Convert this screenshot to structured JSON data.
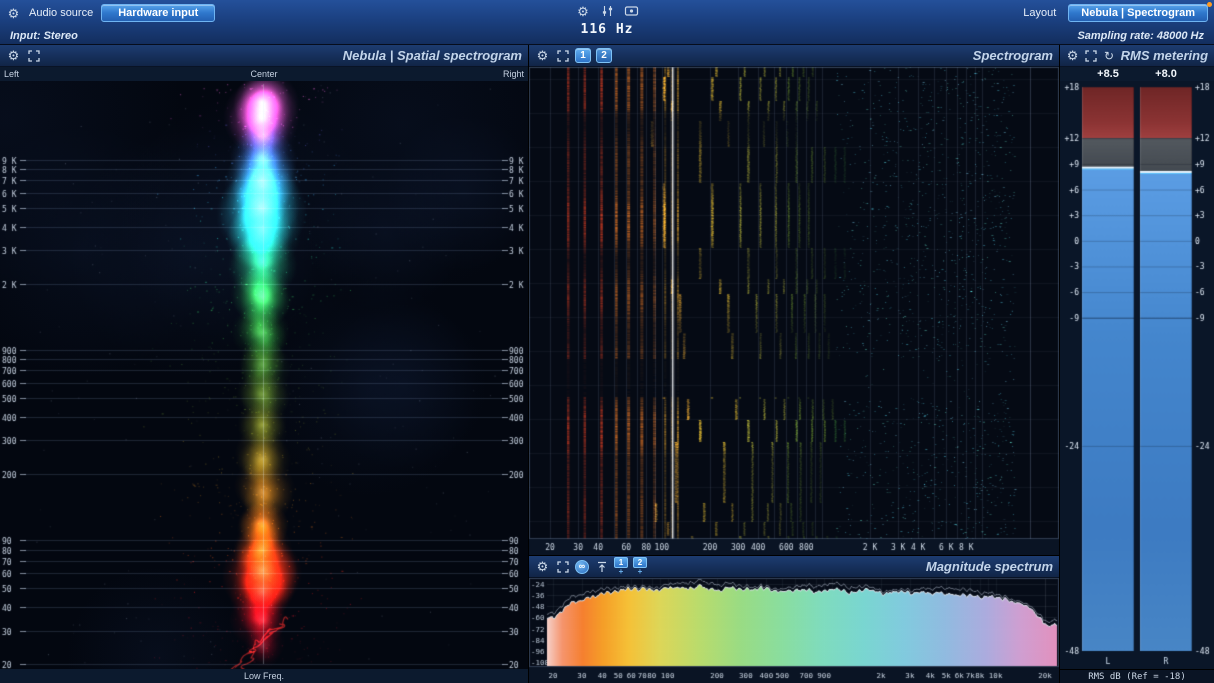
{
  "topbar": {
    "audio_source_label": "Audio source",
    "hardware_input_button": "Hardware input",
    "freq_readout": "116 Hz",
    "layout_button": "Layout",
    "preset_button": "Nebula | Spectrogram",
    "input_label": "Input: Stereo",
    "sampling_rate_label": "Sampling rate: 48000 Hz"
  },
  "panels": {
    "spatial": {
      "title": "Nebula | Spatial spectrogram",
      "left_label": "Left",
      "center_label": "Center",
      "right_label": "Right",
      "bottom_label": "Low Freq."
    },
    "spectrogram": {
      "title": "Spectrogram",
      "button1": "1",
      "button2": "2"
    },
    "magnitude": {
      "title": "Magnitude spectrum",
      "button1": "1",
      "button2": "2",
      "plus": "+",
      "freeze_glyph": "∞"
    },
    "rms": {
      "title": "RMS metering",
      "left_value": "+8.5",
      "right_value": "+8.0",
      "footer": "RMS dB (Ref = -18)"
    }
  },
  "theme": {
    "accent_blue": "#3a8de0",
    "meter_red": "#8c3434",
    "meter_gray": "#4b5158",
    "meter_blue": "#4486cd",
    "value_line": "#eaf6ff"
  },
  "chart_data": [
    {
      "name": "spatial_spectrogram",
      "type": "heatmap",
      "freq_range_hz": [
        20,
        22500
      ],
      "pan_labels": [
        "Left",
        "Center",
        "Right"
      ],
      "low_freq_label": "Low Freq.",
      "freq_ticks": [
        {
          "f": 9000,
          "label": "9 K"
        },
        {
          "f": 8000,
          "label": "8 K"
        },
        {
          "f": 7000,
          "label": "7 K"
        },
        {
          "f": 6000,
          "label": "6 K"
        },
        {
          "f": 5000,
          "label": "5 K"
        },
        {
          "f": 4000,
          "label": "4 K"
        },
        {
          "f": 3000,
          "label": "3 K"
        },
        {
          "f": 2000,
          "label": "2 K"
        },
        {
          "f": 900,
          "label": "900"
        },
        {
          "f": 800,
          "label": "800"
        },
        {
          "f": 700,
          "label": "700"
        },
        {
          "f": 600,
          "label": "600"
        },
        {
          "f": 500,
          "label": "500"
        },
        {
          "f": 400,
          "label": "400"
        },
        {
          "f": 300,
          "label": "300"
        },
        {
          "f": 200,
          "label": "200"
        },
        {
          "f": 90,
          "label": "90"
        },
        {
          "f": 80,
          "label": "80"
        },
        {
          "f": 70,
          "label": "70"
        },
        {
          "f": 60,
          "label": "60"
        },
        {
          "f": 50,
          "label": "50"
        },
        {
          "f": 40,
          "label": "40"
        },
        {
          "f": 30,
          "label": "30"
        },
        {
          "f": 20,
          "label": "20"
        }
      ],
      "energy_stops": [
        {
          "f": 18000,
          "c": "#ff5fd6",
          "r": 26,
          "a": 0.85
        },
        {
          "f": 15000,
          "c": "#f44fd0",
          "r": 30,
          "a": 0.9
        },
        {
          "f": 12000,
          "c": "#7a6bff",
          "r": 24,
          "a": 0.45
        },
        {
          "f": 9500,
          "c": "#4f8cff",
          "r": 26,
          "a": 0.55
        },
        {
          "f": 7000,
          "c": "#3fb9ff",
          "r": 30,
          "a": 0.75
        },
        {
          "f": 5000,
          "c": "#2fd8ee",
          "r": 34,
          "a": 0.95
        },
        {
          "f": 3800,
          "c": "#27e0c8",
          "r": 30,
          "a": 0.75
        },
        {
          "f": 2600,
          "c": "#2fe08a",
          "r": 26,
          "a": 0.55
        },
        {
          "f": 1700,
          "c": "#35d855",
          "r": 28,
          "a": 0.75
        },
        {
          "f": 1100,
          "c": "#3fcc3f",
          "r": 26,
          "a": 0.55
        },
        {
          "f": 750,
          "c": "#63c32f",
          "r": 22,
          "a": 0.42
        },
        {
          "f": 520,
          "c": "#8cc22a",
          "r": 20,
          "a": 0.38
        },
        {
          "f": 360,
          "c": "#b9c21f",
          "r": 20,
          "a": 0.38
        },
        {
          "f": 240,
          "c": "#e0b018",
          "r": 22,
          "a": 0.48
        },
        {
          "f": 160,
          "c": "#f09010",
          "r": 22,
          "a": 0.52
        },
        {
          "f": 110,
          "c": "#ff7708",
          "r": 22,
          "a": 0.6
        },
        {
          "f": 80,
          "c": "#ff5505",
          "r": 24,
          "a": 0.7
        },
        {
          "f": 62,
          "c": "#ff2a06",
          "r": 30,
          "a": 1.0
        },
        {
          "f": 48,
          "c": "#ff1208",
          "r": 26,
          "a": 0.88
        },
        {
          "f": 34,
          "c": "#e00a14",
          "r": 22,
          "a": 0.65
        },
        {
          "f": 25,
          "c": "#b00616",
          "r": 18,
          "a": 0.45
        }
      ]
    },
    {
      "name": "spectrogram",
      "type": "heatmap",
      "freq_range_hz": [
        20,
        30000
      ],
      "cursor_freq_hz": 116,
      "fundamental_hz": 116,
      "harmonics": 8,
      "low_band_freqs": [
        26,
        33,
        42,
        52,
        62,
        75,
        90,
        105,
        116,
        126
      ],
      "silence_rows": [
        [
          292,
          330
        ]
      ],
      "speckle_range_hz": [
        1200,
        16000
      ],
      "x_ticks": [
        {
          "f": 20,
          "label": "20"
        },
        {
          "f": 30,
          "label": "30"
        },
        {
          "f": 40,
          "label": "40"
        },
        {
          "f": 60,
          "label": "60"
        },
        {
          "f": 80,
          "label": "80"
        },
        {
          "f": 100,
          "label": "100"
        },
        {
          "f": 200,
          "label": "200"
        },
        {
          "f": 300,
          "label": "300"
        },
        {
          "f": 400,
          "label": "400"
        },
        {
          "f": 600,
          "label": "600"
        },
        {
          "f": 800,
          "label": "800"
        },
        {
          "f": 2000,
          "label": "2 K"
        },
        {
          "f": 3000,
          "label": "3 K"
        },
        {
          "f": 4000,
          "label": "4 K"
        },
        {
          "f": 6000,
          "label": "6 K"
        },
        {
          "f": 8000,
          "label": "8 K"
        }
      ]
    },
    {
      "name": "magnitude_spectrum",
      "type": "area",
      "ylabel_unit": "dB",
      "y_ticks": [
        -24,
        -36,
        -48,
        -60,
        -72,
        -84,
        -96,
        -108
      ],
      "x_ticks": [
        {
          "f": 20,
          "label": "20"
        },
        {
          "f": 30,
          "label": "30"
        },
        {
          "f": 40,
          "label": "40"
        },
        {
          "f": 50,
          "label": "50"
        },
        {
          "f": 60,
          "label": "60"
        },
        {
          "f": 70,
          "label": "70"
        },
        {
          "f": 80,
          "label": "80"
        },
        {
          "f": 100,
          "label": "100"
        },
        {
          "f": 200,
          "label": "200"
        },
        {
          "f": 300,
          "label": "300"
        },
        {
          "f": 400,
          "label": "400"
        },
        {
          "f": 500,
          "label": "500"
        },
        {
          "f": 700,
          "label": "700"
        },
        {
          "f": 900,
          "label": "900"
        },
        {
          "f": 2000,
          "label": "2k"
        },
        {
          "f": 3000,
          "label": "3k"
        },
        {
          "f": 4000,
          "label": "4k"
        },
        {
          "f": 5000,
          "label": "5k"
        },
        {
          "f": 6000,
          "label": "6k"
        },
        {
          "f": 7000,
          "label": "7k"
        },
        {
          "f": 8000,
          "label": "8k"
        },
        {
          "f": 10000,
          "label": "10k"
        },
        {
          "f": 20000,
          "label": "20k"
        }
      ],
      "points": [
        [
          20,
          -60
        ],
        [
          25,
          -46
        ],
        [
          32,
          -40
        ],
        [
          40,
          -35
        ],
        [
          50,
          -31
        ],
        [
          63,
          -29
        ],
        [
          80,
          -31
        ],
        [
          100,
          -28
        ],
        [
          125,
          -30
        ],
        [
          160,
          -27
        ],
        [
          200,
          -30
        ],
        [
          250,
          -28
        ],
        [
          315,
          -31
        ],
        [
          400,
          -29
        ],
        [
          500,
          -32
        ],
        [
          630,
          -29
        ],
        [
          800,
          -33
        ],
        [
          1000,
          -30
        ],
        [
          1250,
          -33
        ],
        [
          1600,
          -31
        ],
        [
          2000,
          -34
        ],
        [
          2500,
          -32
        ],
        [
          3150,
          -35
        ],
        [
          4000,
          -33
        ],
        [
          5000,
          -36
        ],
        [
          6300,
          -34
        ],
        [
          8000,
          -38
        ],
        [
          10000,
          -37
        ],
        [
          12500,
          -42
        ],
        [
          16000,
          -50
        ],
        [
          20000,
          -68
        ]
      ],
      "fill_stops": [
        [
          0,
          "#ffd8d0"
        ],
        [
          0.03,
          "#ff9a70"
        ],
        [
          0.07,
          "#ff8430"
        ],
        [
          0.11,
          "#ffa428"
        ],
        [
          0.16,
          "#ffc838"
        ],
        [
          0.22,
          "#e6de5a"
        ],
        [
          0.3,
          "#c0e470"
        ],
        [
          0.38,
          "#9fe488"
        ],
        [
          0.46,
          "#8fe6a4"
        ],
        [
          0.54,
          "#84e4c4"
        ],
        [
          0.62,
          "#7eded8"
        ],
        [
          0.7,
          "#86d2e6"
        ],
        [
          0.78,
          "#96c2e8"
        ],
        [
          0.86,
          "#b2b2e6"
        ],
        [
          0.93,
          "#d8a4d8"
        ],
        [
          1,
          "#eb96c4"
        ]
      ]
    },
    {
      "name": "rms_meters",
      "type": "bar",
      "channels": [
        "L",
        "R"
      ],
      "values_db": [
        8.5,
        8.0
      ],
      "range_db": [
        -48,
        18
      ],
      "ref_db": -18,
      "scale_ticks": [
        {
          "db": 18,
          "label": "+18"
        },
        {
          "db": 12,
          "label": "+12"
        },
        {
          "db": 9,
          "label": "+9"
        },
        {
          "db": 6,
          "label": "+6"
        },
        {
          "db": 3,
          "label": "+3"
        },
        {
          "db": 0,
          "label": "0"
        },
        {
          "db": -3,
          "label": "-3"
        },
        {
          "db": -6,
          "label": "-6"
        },
        {
          "db": -9,
          "label": "-9"
        },
        {
          "db": -24,
          "label": "-24"
        },
        {
          "db": -48,
          "label": "-48"
        }
      ]
    }
  ]
}
